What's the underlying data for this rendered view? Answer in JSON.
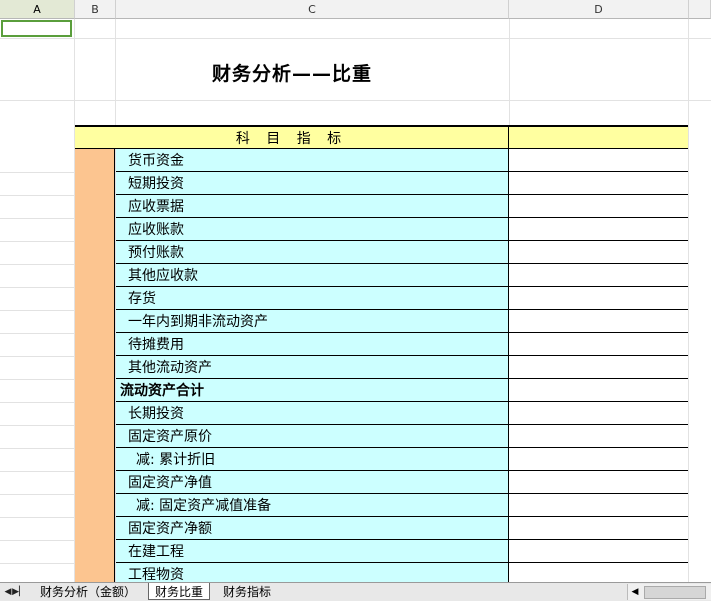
{
  "columns": [
    "A",
    "B",
    "C",
    "D"
  ],
  "title": "财务分析——比重",
  "header_label": "科 目 指 标",
  "rows": [
    {
      "label": "货币资金"
    },
    {
      "label": "短期投资"
    },
    {
      "label": "应收票据"
    },
    {
      "label": "应收账款"
    },
    {
      "label": "预付账款"
    },
    {
      "label": "其他应收款"
    },
    {
      "label": "存货"
    },
    {
      "label": "一年内到期非流动资产"
    },
    {
      "label": "待摊费用"
    },
    {
      "label": "其他流动资产"
    },
    {
      "label": "流动资产合计"
    },
    {
      "label": "长期投资"
    },
    {
      "label": "固定资产原价"
    },
    {
      "label": "减: 累计折旧"
    },
    {
      "label": "固定资产净值"
    },
    {
      "label": "减: 固定资产减值准备"
    },
    {
      "label": "固定资产净额"
    },
    {
      "label": "在建工程"
    },
    {
      "label": "工程物资"
    }
  ],
  "sheet_tabs": [
    "财务分析（金额）",
    "财务比重",
    "财务指标"
  ],
  "active_tab": "财务比重",
  "colors": {
    "header_fill": "#ffffa0",
    "label_fill": "#ccffff",
    "side_fill": "#fcc590",
    "selection": "#5a9e3c"
  }
}
